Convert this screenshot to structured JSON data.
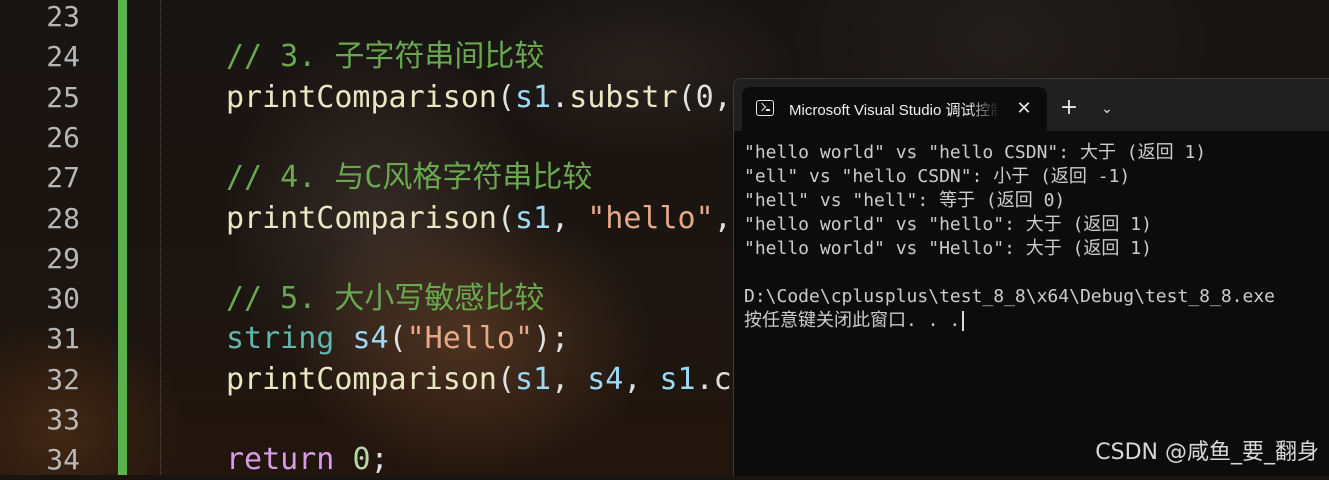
{
  "editor": {
    "line_numbers": [
      "23",
      "24",
      "25",
      "26",
      "27",
      "28",
      "29",
      "30",
      "31",
      "32",
      "33",
      "34"
    ],
    "lines": [
      {
        "tokens": []
      },
      {
        "tokens": [
          {
            "t": "cmt",
            "v": "// 3. 子字符串间比较"
          }
        ]
      },
      {
        "tokens": [
          {
            "t": "fn",
            "v": "printComparison"
          },
          {
            "t": "pun",
            "v": "("
          },
          {
            "t": "var",
            "v": "s1"
          },
          {
            "t": "pun",
            "v": "."
          },
          {
            "t": "fn",
            "v": "substr"
          },
          {
            "t": "pun",
            "v": "(0,"
          }
        ]
      },
      {
        "tokens": []
      },
      {
        "tokens": [
          {
            "t": "cmt",
            "v": "// 4. 与C风格字符串比较"
          }
        ]
      },
      {
        "tokens": [
          {
            "t": "fn",
            "v": "printComparison"
          },
          {
            "t": "pun",
            "v": "("
          },
          {
            "t": "var",
            "v": "s1"
          },
          {
            "t": "pun",
            "v": ", "
          },
          {
            "t": "str",
            "v": "\"hello\""
          },
          {
            "t": "pun",
            "v": ","
          }
        ]
      },
      {
        "tokens": []
      },
      {
        "tokens": [
          {
            "t": "cmt",
            "v": "// 5. 大小写敏感比较"
          }
        ]
      },
      {
        "tokens": [
          {
            "t": "kw",
            "v": "string"
          },
          {
            "t": "pun",
            "v": " "
          },
          {
            "t": "var",
            "v": "s4"
          },
          {
            "t": "pun",
            "v": "("
          },
          {
            "t": "str",
            "v": "\"Hello\""
          },
          {
            "t": "pun",
            "v": ");"
          }
        ]
      },
      {
        "tokens": [
          {
            "t": "fn",
            "v": "printComparison"
          },
          {
            "t": "pun",
            "v": "("
          },
          {
            "t": "var",
            "v": "s1"
          },
          {
            "t": "pun",
            "v": ", "
          },
          {
            "t": "var",
            "v": "s4"
          },
          {
            "t": "pun",
            "v": ", "
          },
          {
            "t": "var",
            "v": "s1"
          },
          {
            "t": "pun",
            "v": ".c"
          }
        ]
      },
      {
        "tokens": []
      },
      {
        "tokens": [
          {
            "t": "kwp",
            "v": "return"
          },
          {
            "t": "pun",
            "v": " "
          },
          {
            "t": "num",
            "v": "0"
          },
          {
            "t": "pun",
            "v": ";"
          }
        ]
      }
    ]
  },
  "terminal": {
    "tab_title": "Microsoft Visual Studio 调试控制台",
    "tab_icon": "terminal-icon",
    "close_symbol": "✕",
    "new_tab_symbol": "+",
    "dropdown_symbol": "⌄",
    "output": [
      "\"hello world\" vs \"hello CSDN\": 大于 (返回 1)",
      "\"ell\" vs \"hello CSDN\": 小于 (返回 -1)",
      "\"hell\" vs \"hell\": 等于 (返回 0)",
      "\"hello world\" vs \"hello\": 大于 (返回 1)",
      "\"hello world\" vs \"Hello\": 大于 (返回 1)",
      "",
      "D:\\Code\\cplusplus\\test_8_8\\x64\\Debug\\test_8_8.exe",
      "按任意键关闭此窗口. . ."
    ]
  },
  "watermark": "CSDN @咸鱼_要_翻身",
  "colors": {
    "change_bar": "#59b34a",
    "comment": "#6aa84f",
    "function": "#e9e7c4",
    "variable": "#9bd9f7",
    "keyword": "#5fb6ad",
    "string": "#e7a789",
    "terminal_bg": "#0c0c0c"
  }
}
